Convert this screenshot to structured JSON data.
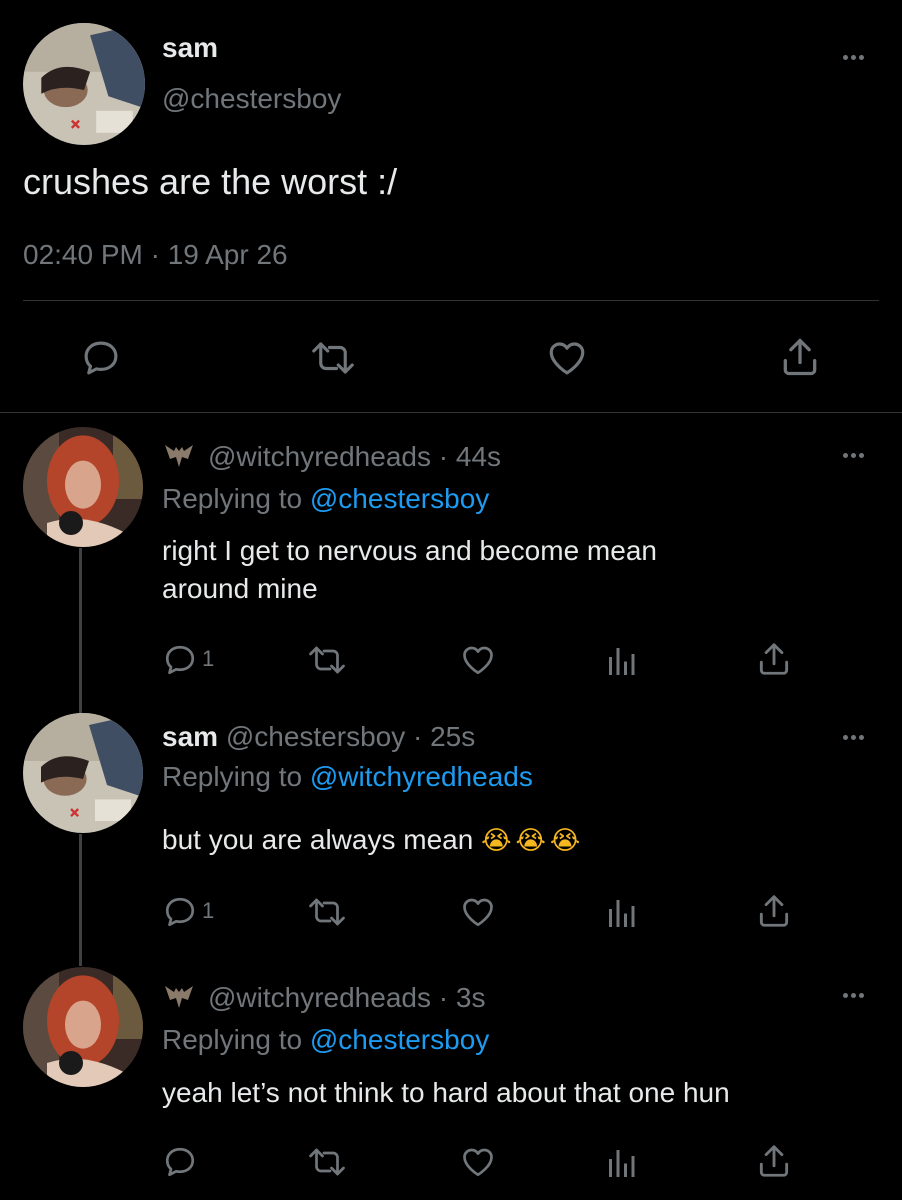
{
  "main_tweet": {
    "display_name": "sam",
    "handle": "@chestersboy",
    "text": "crushes are the worst :/",
    "timestamp": "02:40 PM · 19 Apr 26"
  },
  "replies": [
    {
      "display_name": "",
      "handle": "@witchyredheads",
      "time": "· 44s",
      "replying_prefix": "Replying to",
      "replying_to": "@chestersboy",
      "text_lines": [
        "right I get to nervous and become mean",
        "around mine"
      ],
      "reply_count": "1"
    },
    {
      "display_name": "sam",
      "handle": "@chestersboy",
      "time": "· 25s",
      "replying_prefix": "Replying to",
      "replying_to": "@witchyredheads",
      "text": "but you are always mean",
      "emoji": "😭😭😭",
      "reply_count": "1"
    },
    {
      "display_name": "",
      "handle": "@witchyredheads",
      "time": "· 3s",
      "replying_prefix": "Replying to",
      "replying_to": "@chestersboy",
      "text": "yeah let’s not think to hard about that one hun",
      "reply_count": ""
    }
  ],
  "icons": {
    "reply": "speech-bubble-icon",
    "retweet": "retweet-icon",
    "like": "heart-icon",
    "views": "bar-chart-icon",
    "share": "share-icon",
    "more": "more-dots-icon",
    "name_emoji": "bat-icon"
  },
  "colors": {
    "background": "#000000",
    "text": "#e7e9ea",
    "muted": "#71767b",
    "link": "#1d9bf0",
    "divider": "#2f3336"
  }
}
